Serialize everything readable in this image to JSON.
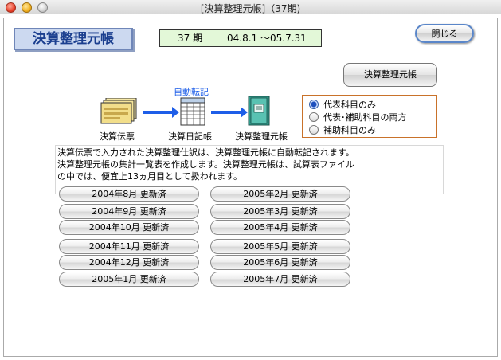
{
  "window": {
    "title": "[決算整理元帳]（37期)"
  },
  "header": {
    "heading": "決算整理元帳",
    "period_no": "37 期",
    "period_range": "04.8.1 ～05.7.31"
  },
  "buttons": {
    "close_label": "閉じる",
    "ledger_label": "決算整理元帳"
  },
  "flow": {
    "auto_transfer_label": "自動転記",
    "step1": "決算伝票",
    "step2": "決算日記帳",
    "step3": "決算整理元帳",
    "arrow_color": "#1e5ee8"
  },
  "radio_options": [
    {
      "label": "代表科目のみ",
      "selected": true
    },
    {
      "label": "代表･補助科目の両方",
      "selected": false
    },
    {
      "label": "補助科目のみ",
      "selected": false
    }
  ],
  "description": [
    "決算伝票で入力された決算整理仕訳は、決算整理元帳に自動転記されます。",
    "決算整理元帳の集計一覧表を作成します。決算整理元帳は、試算表ファイル",
    "の中では、便宜上13ヵ月目として扱われます。"
  ],
  "months_left": [
    "2004年8月 更新済",
    "2004年9月 更新済",
    "2004年10月 更新済",
    "2004年11月 更新済",
    "2004年12月 更新済",
    "2005年1月 更新済"
  ],
  "months_right": [
    "2005年2月 更新済",
    "2005年3月 更新済",
    "2005年4月 更新済",
    "2005年5月 更新済",
    "2005年6月 更新済",
    "2005年7月 更新済"
  ]
}
